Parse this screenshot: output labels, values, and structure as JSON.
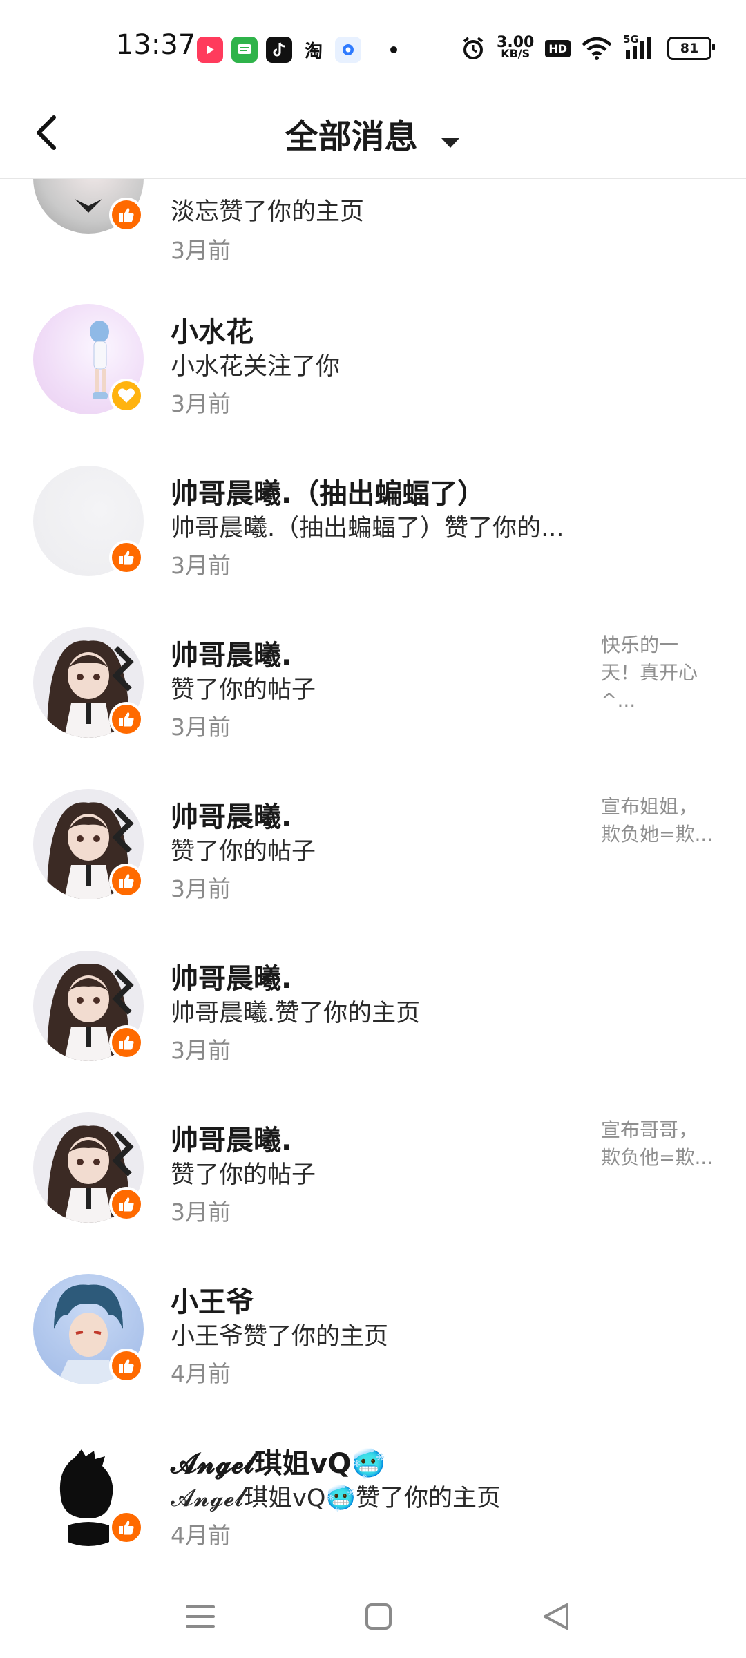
{
  "status_bar": {
    "time": "13:37",
    "app_icons": [
      "youtube-icon",
      "messages-icon",
      "tiktok-icon",
      "taobao-icon",
      "browser-icon"
    ],
    "taobao_char": "淘",
    "net_speed": "3.00",
    "net_unit": "KB/S",
    "hd_label": "HD",
    "signal_label": "5G",
    "battery": "81"
  },
  "header": {
    "title": "全部消息"
  },
  "notifications": [
    {
      "name": "",
      "desc": "淡忘赞了你的主页",
      "time": "3月前",
      "type": "like",
      "preview": ""
    },
    {
      "name": "小水花",
      "desc": "小水花关注了你",
      "time": "3月前",
      "type": "follow",
      "preview": ""
    },
    {
      "name": "帅哥晨曦.（抽出蝙蝠了）",
      "desc": "帅哥晨曦.（抽出蝙蝠了）赞了你的...",
      "time": "3月前",
      "type": "like",
      "preview": ""
    },
    {
      "name": "帅哥晨曦.",
      "desc": "赞了你的帖子",
      "time": "3月前",
      "type": "like",
      "preview": "快乐的一天！真开心^..."
    },
    {
      "name": "帅哥晨曦.",
      "desc": "赞了你的帖子",
      "time": "3月前",
      "type": "like",
      "preview": "宣布姐姐，欺负她=欺..."
    },
    {
      "name": "帅哥晨曦.",
      "desc": "帅哥晨曦.赞了你的主页",
      "time": "3月前",
      "type": "like",
      "preview": ""
    },
    {
      "name": "帅哥晨曦.",
      "desc": "赞了你的帖子",
      "time": "3月前",
      "type": "like",
      "preview": "宣布哥哥，欺负他=欺..."
    },
    {
      "name": "小王爷",
      "desc": "小王爷赞了你的主页",
      "time": "4月前",
      "type": "like",
      "preview": ""
    },
    {
      "name": "𝓐𝓷𝓰𝓮𝓵琪姐vQ🥶",
      "desc": "𝓐𝓷𝓰𝓮𝓵琪姐vQ🥶赞了你的主页",
      "time": "4月前",
      "type": "like",
      "preview": ""
    }
  ],
  "nav": {
    "icons": [
      "menu-icon",
      "home-icon",
      "back-icon"
    ]
  }
}
